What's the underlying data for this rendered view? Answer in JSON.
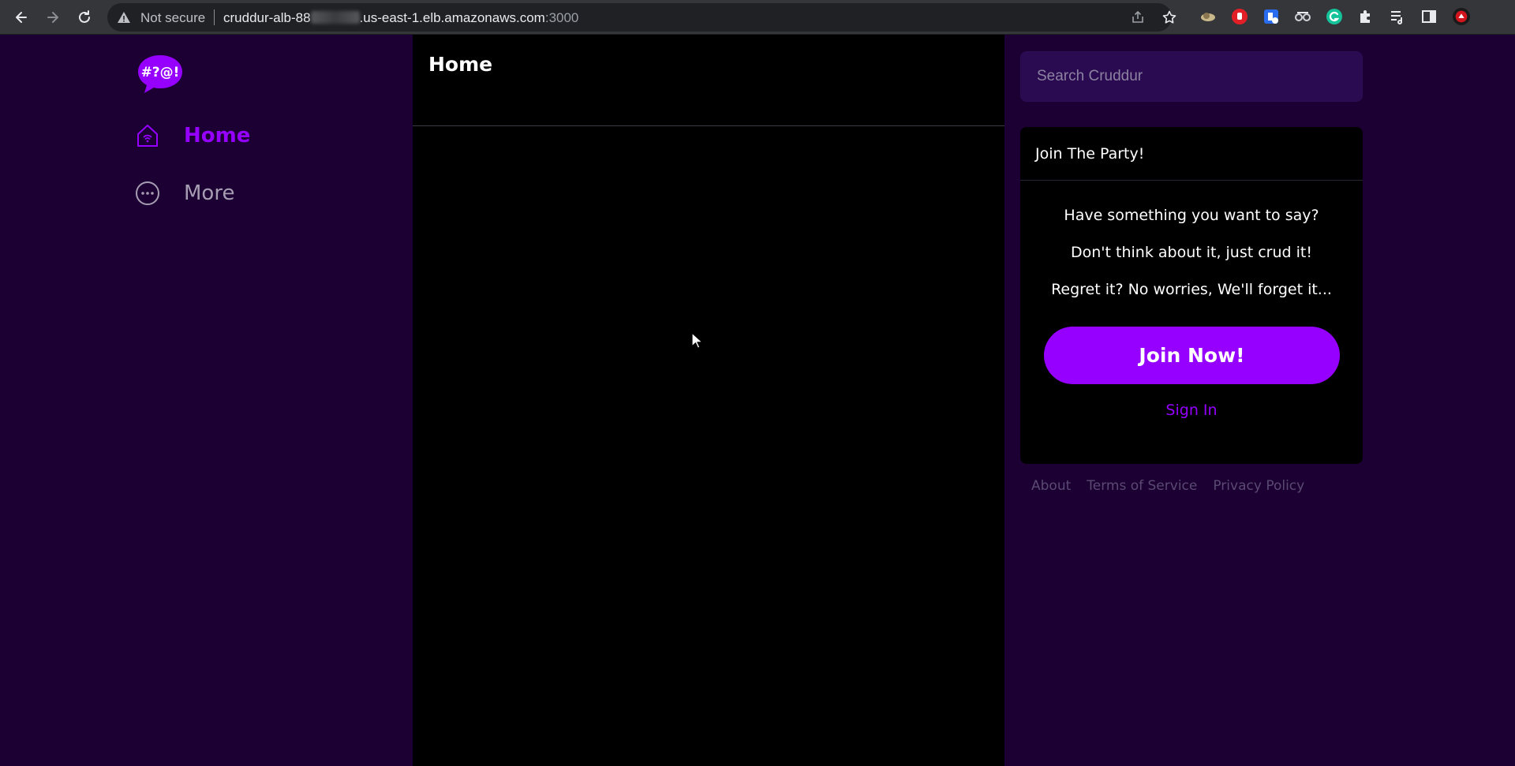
{
  "browser": {
    "security_label": "Not secure",
    "url_host_start": "cruddur-alb-88",
    "url_host_end": ".us-east-1.elb.amazonaws.com",
    "url_port": ":3000",
    "icons": [
      "back-icon",
      "forward-icon",
      "reload-icon",
      "warning-icon",
      "share-icon",
      "bookmark-star-icon",
      "extensions-puzzle-icon",
      "reading-list-icon",
      "side-panel-icon",
      "profile-avatar-icon"
    ]
  },
  "sidebar": {
    "logo_text": "#?@!",
    "items": [
      {
        "label": "Home",
        "icon": "home-icon",
        "active": true
      },
      {
        "label": "More",
        "icon": "more-dots-icon",
        "active": false
      }
    ]
  },
  "main": {
    "title": "Home"
  },
  "search": {
    "placeholder": "Search Cruddur"
  },
  "join_card": {
    "title": "Join The Party!",
    "lines": [
      "Have something you want to say?",
      "Don't think about it, just crud it!",
      "Regret it? No worries, We'll forget it..."
    ],
    "join_button": "Join Now!",
    "sign_in": "Sign In"
  },
  "footer": {
    "links": [
      "About",
      "Terms of Service",
      "Privacy Policy"
    ]
  },
  "colors": {
    "accent": "#9500ff",
    "sidebar_bg": "#1c0033",
    "content_bg": "#000000",
    "search_bg": "#2a0a50"
  }
}
